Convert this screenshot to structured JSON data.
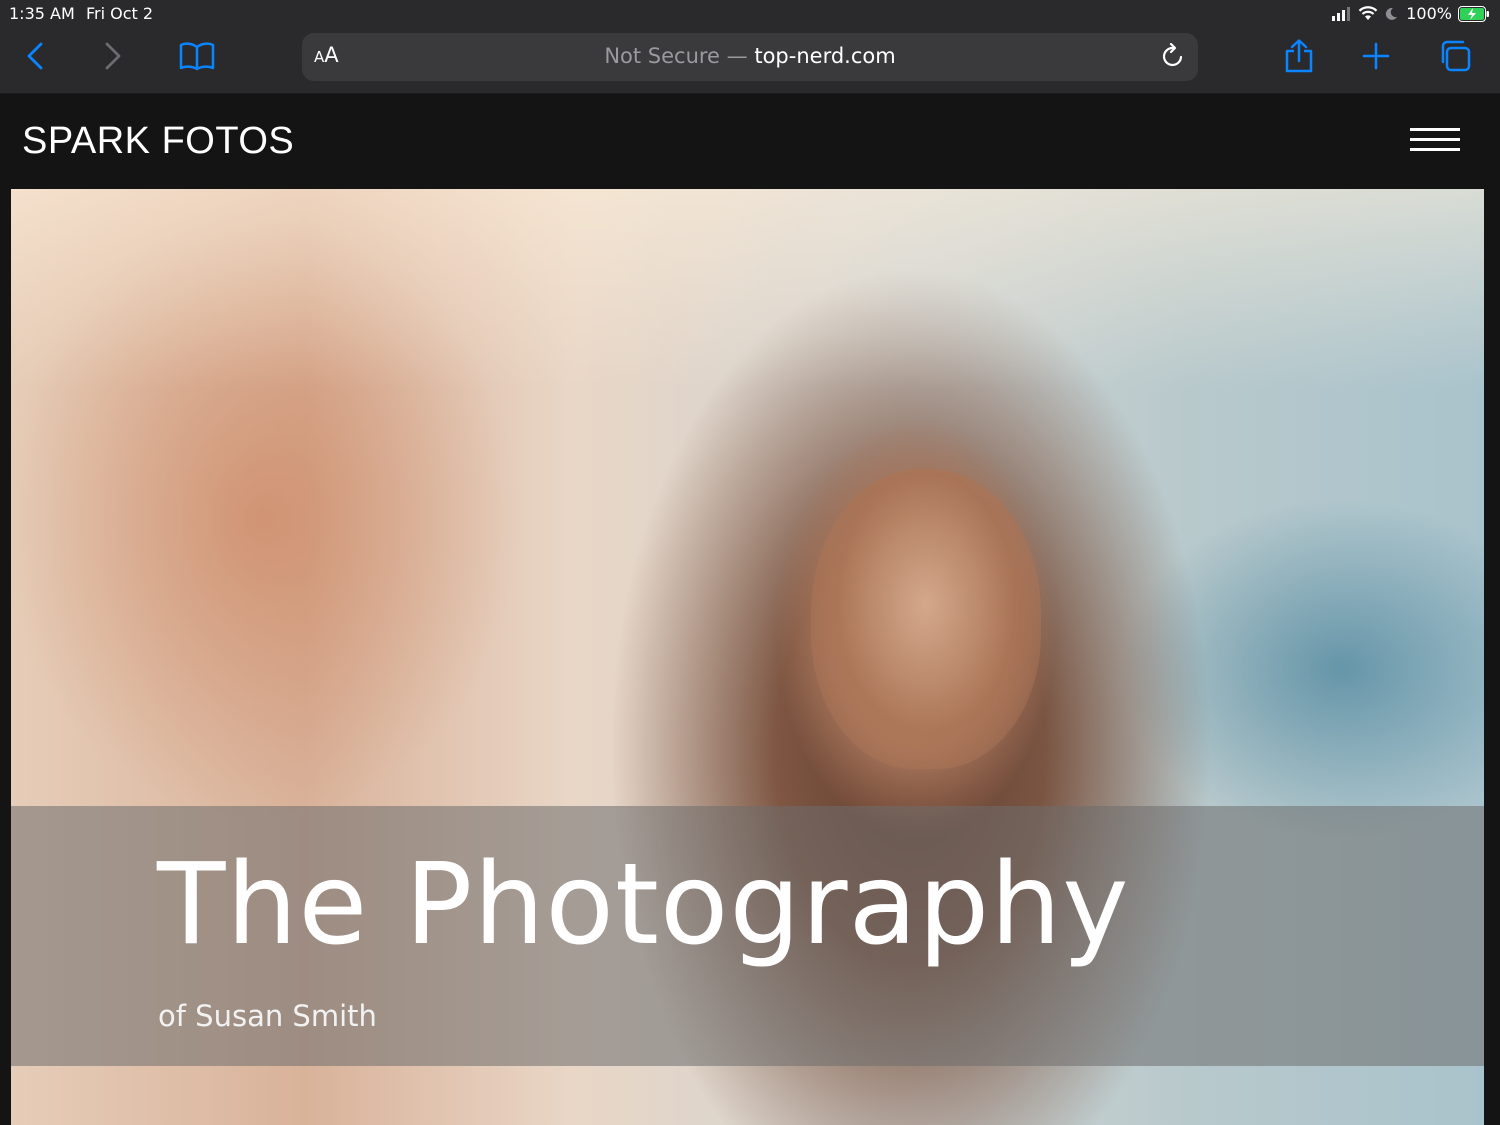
{
  "status_bar": {
    "time": "1:35 AM",
    "date": "Fri Oct 2",
    "battery": "100%",
    "icons": [
      "signal-icon",
      "wifi-icon",
      "do-not-disturb-icon",
      "battery-charging-icon"
    ]
  },
  "browser": {
    "text_size_button": {
      "small": "A",
      "large": "A"
    },
    "security_label": "Not Secure",
    "separator": " — ",
    "domain": "top-nerd.com",
    "toolbar_icons": [
      "back-icon",
      "forward-icon",
      "bookmarks-icon",
      "reload-icon",
      "share-icon",
      "new-tab-icon",
      "tabs-icon"
    ],
    "accent_color": "#0a84ff"
  },
  "site": {
    "logo": "SPARK FOTOS",
    "menu_icon": "hamburger-menu-icon",
    "hero": {
      "title": "The Photography",
      "subtitle": "of Susan Smith"
    }
  }
}
